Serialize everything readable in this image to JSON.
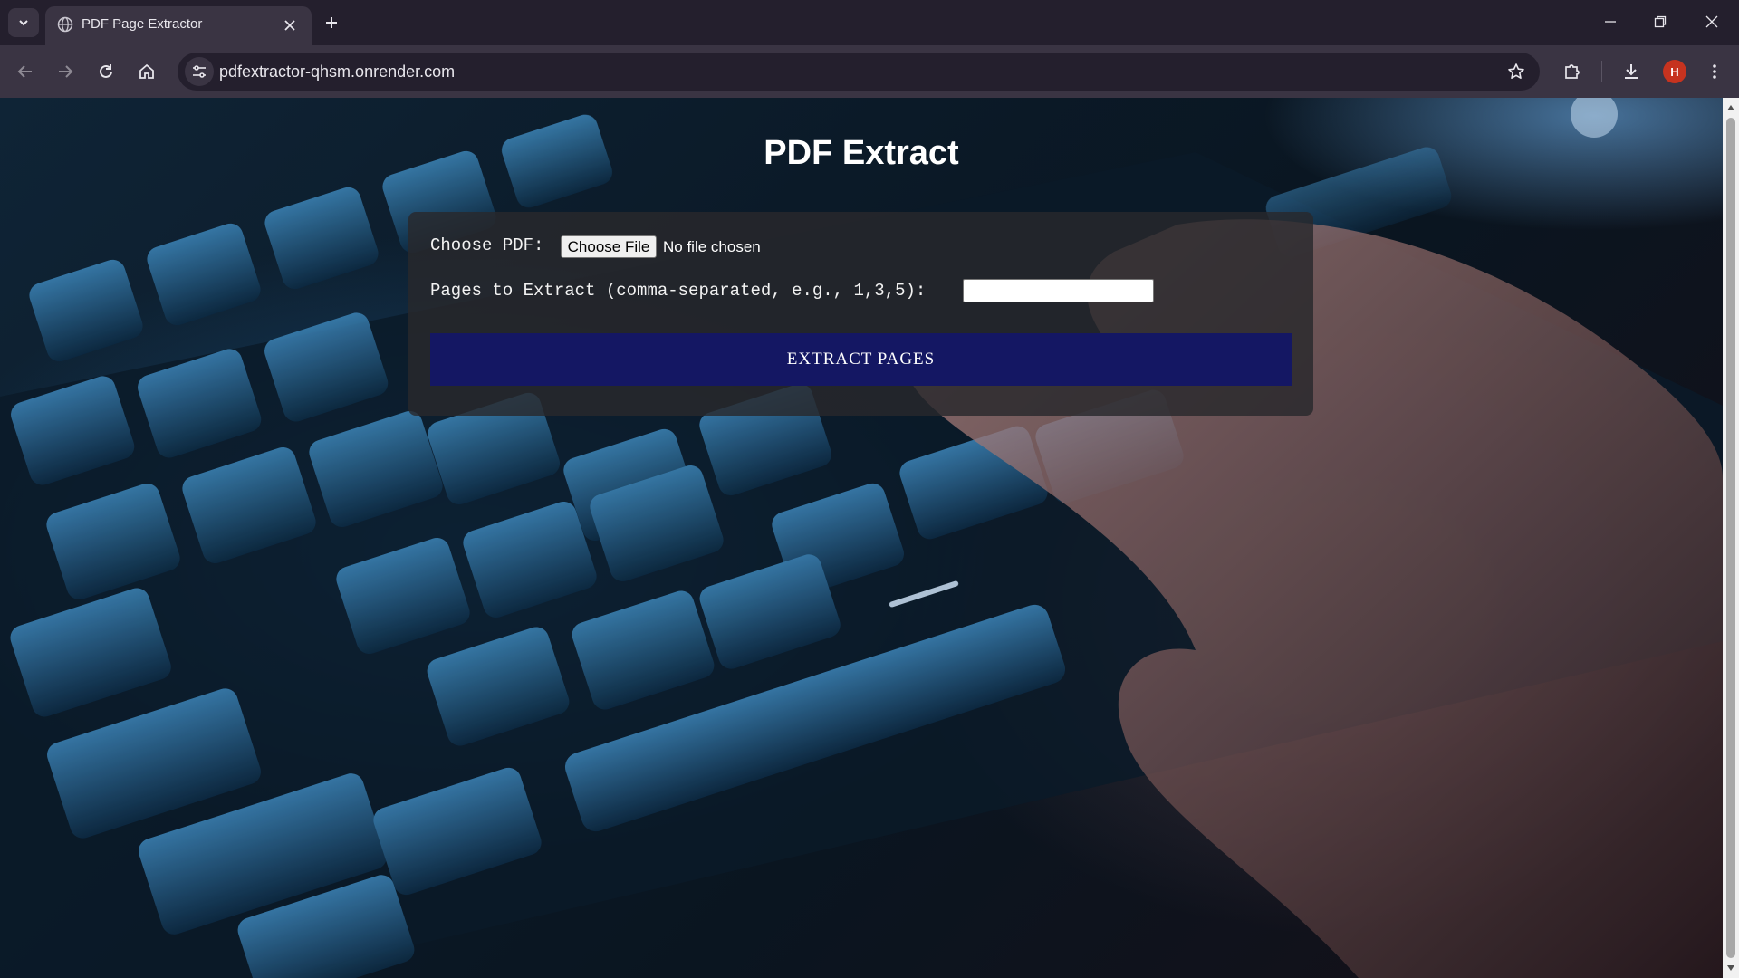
{
  "browser": {
    "tab_title": "PDF Page Extractor",
    "url": "pdfextractor-qhsm.onrender.com",
    "profile_initial": "H",
    "profile_color": "#c6331f"
  },
  "page": {
    "title": "PDF Extract",
    "choose_label": "Choose PDF:",
    "choose_button": "Choose File",
    "file_status": "No file chosen",
    "pages_label": "Pages to Extract (comma-separated, e.g., 1,3,5):",
    "pages_value": "",
    "extract_button": "EXTRACT PAGES",
    "button_color": "#141763"
  },
  "icons": {
    "tab_list": "chevron-down-icon",
    "favicon": "globe-icon",
    "tab_close": "close-icon",
    "new_tab": "plus-icon",
    "back": "arrow-left-icon",
    "forward": "arrow-right-icon",
    "reload": "reload-icon",
    "home": "home-icon",
    "site_info": "tune-icon",
    "bookmark": "star-icon",
    "extensions": "puzzle-icon",
    "downloads": "download-icon",
    "menu": "kebab-menu-icon"
  }
}
